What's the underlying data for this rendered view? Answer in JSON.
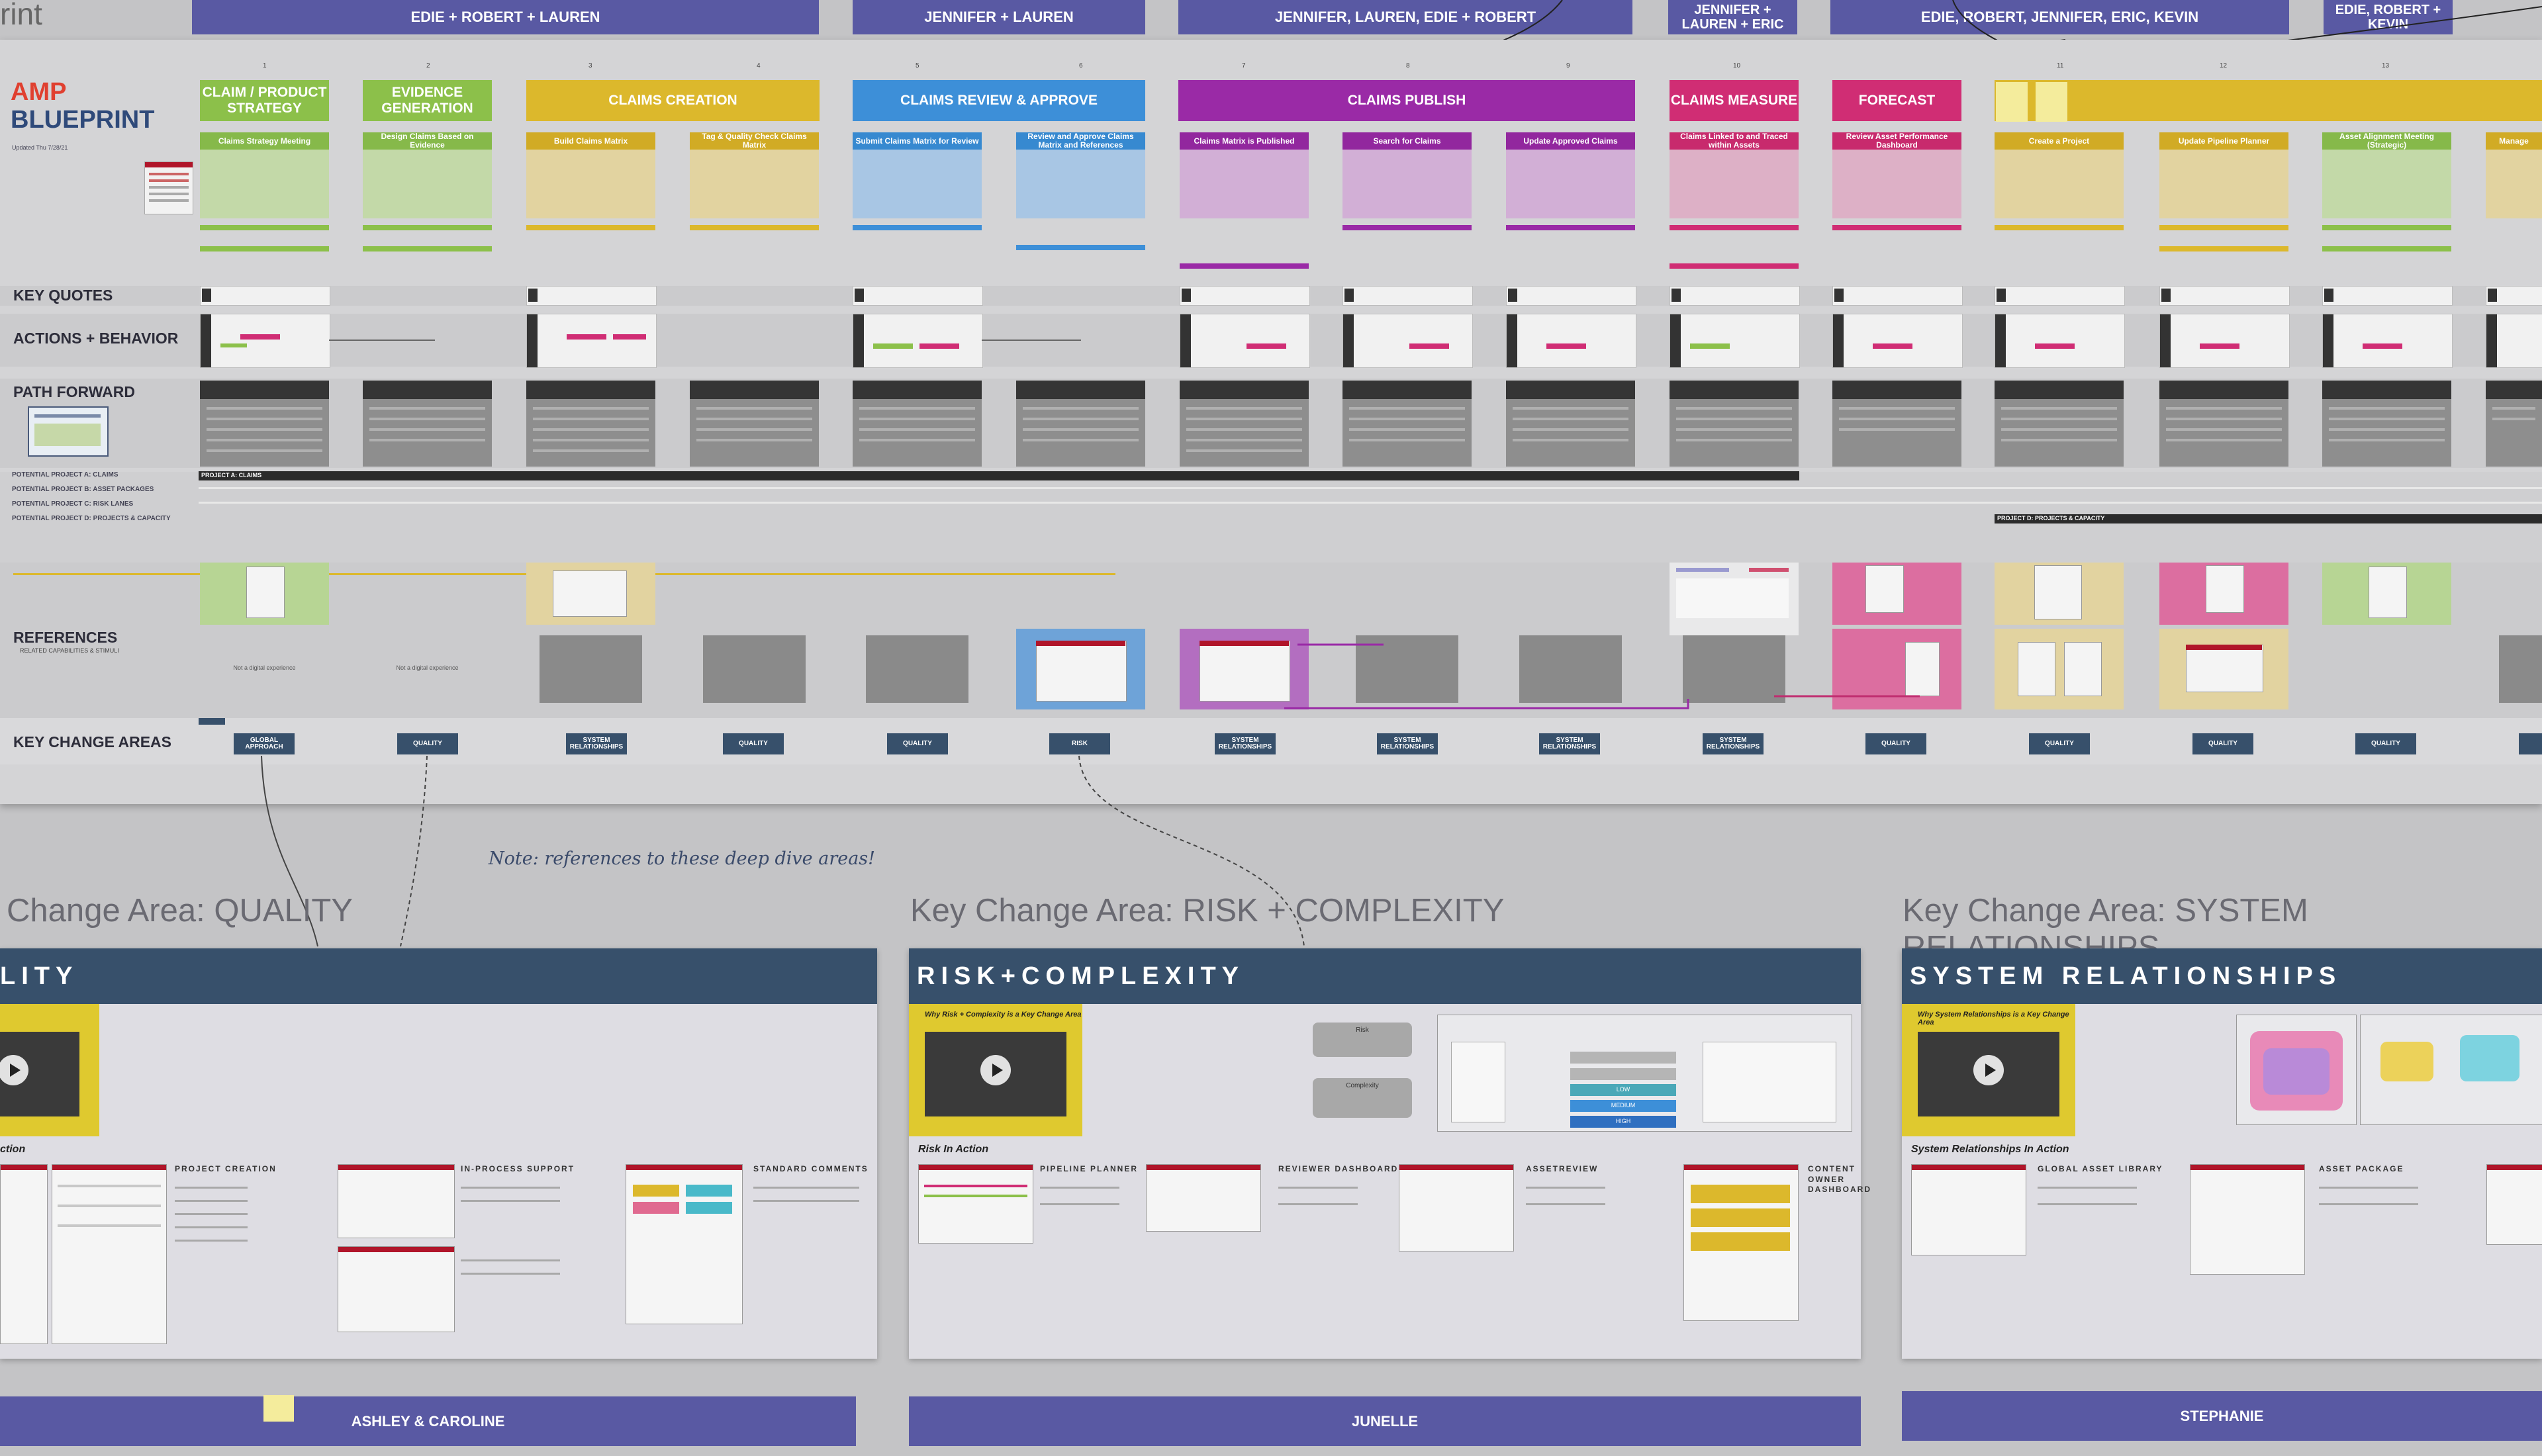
{
  "board": {
    "frame_title": "rint",
    "title_line1": "AMP",
    "title_line2": "BLUEPRINT",
    "updated": "Updated Thu 7/28/21",
    "teams": [
      {
        "label": "EDIE + ROBERT + LAUREN"
      },
      {
        "label": "JENNIFER + LAUREN"
      },
      {
        "label": "JENNIFER, LAUREN, EDIE + ROBERT"
      },
      {
        "label": "JENNIFER + LAUREN + ERIC"
      },
      {
        "label": "EDIE, ROBERT, JENNIFER, ERIC, KEVIN"
      },
      {
        "label": "EDIE, ROBERT + KEVIN"
      }
    ],
    "step_numbers": [
      "1",
      "2",
      "3",
      "4",
      "5",
      "6",
      "7",
      "8",
      "9",
      "10",
      "11",
      "12",
      "13"
    ],
    "stages": [
      {
        "label": "CLAIM / PRODUCT STRATEGY",
        "color": "#8cc04a"
      },
      {
        "label": "EVIDENCE GENERATION",
        "color": "#8cc04a"
      },
      {
        "label": "CLAIMS CREATION",
        "color": "#dcb82c"
      },
      {
        "label": "CLAIMS REVIEW & APPROVE",
        "color": "#3d8fd8"
      },
      {
        "label": "CLAIMS PUBLISH",
        "color": "#9a2aa6"
      },
      {
        "label": "CLAIMS MEASURE",
        "color": "#d02d74"
      },
      {
        "label": "FORECAST",
        "color": "#d02d74"
      }
    ],
    "sub_steps": [
      {
        "label": "Claims Strategy Meeting"
      },
      {
        "label": "Design Claims Based on Evidence"
      },
      {
        "label": "Build Claims Matrix"
      },
      {
        "label": "Tag & Quality Check Claims Matrix"
      },
      {
        "label": "Submit Claims Matrix for Review"
      },
      {
        "label": "Review and Approve Claims Matrix and References"
      },
      {
        "label": "Claims Matrix is Published"
      },
      {
        "label": "Search for Claims"
      },
      {
        "label": "Update Approved Claims"
      },
      {
        "label": "Claims Linked to and Traced within Assets"
      },
      {
        "label": "Review Asset Performance Dashboard"
      },
      {
        "label": "Create a Project"
      },
      {
        "label": "Update Pipeline Planner"
      },
      {
        "label": "Asset Alignment Meeting (Strategic)"
      },
      {
        "label": "Manage"
      }
    ],
    "row_labels": {
      "key_quotes": "KEY QUOTES",
      "actions": "ACTIONS + BEHAVIOR",
      "path_forward": "PATH FORWARD",
      "references": "REFERENCES",
      "references_sub": "RELATED CAPABILITIES & STIMULI",
      "key_change_areas": "KEY CHANGE AREAS"
    },
    "potential_projects": [
      {
        "label": "POTENTIAL PROJECT A: CLAIMS"
      },
      {
        "label": "POTENTIAL PROJECT B: ASSET PACKAGES"
      },
      {
        "label": "POTENTIAL PROJECT C: RISK LANES"
      },
      {
        "label": "POTENTIAL PROJECT D: PROJECTS & CAPACITY"
      }
    ],
    "project_bar_a": "PROJECT A: CLAIMS",
    "project_bar_d": "PROJECT D: PROJECTS & CAPACITY",
    "key_change_tags": [
      {
        "label": "GLOBAL APPROACH"
      },
      {
        "label": "QUALITY"
      },
      {
        "label": "SYSTEM RELATIONSHIPS"
      },
      {
        "label": "QUALITY"
      },
      {
        "label": "QUALITY"
      },
      {
        "label": "RISK"
      },
      {
        "label": "SYSTEM RELATIONSHIPS"
      },
      {
        "label": "SYSTEM RELATIONSHIPS"
      },
      {
        "label": "SYSTEM RELATIONSHIPS"
      },
      {
        "label": "SYSTEM RELATIONSHIPS"
      },
      {
        "label": "QUALITY"
      },
      {
        "label": "QUALITY"
      },
      {
        "label": "QUALITY"
      },
      {
        "label": "QUALITY"
      }
    ],
    "ref_captions": [
      {
        "label": "Not a digital experience"
      },
      {
        "label": "Not a digital experience"
      }
    ]
  },
  "note": "Note: references to these deep dive areas!",
  "deep_dives": [
    {
      "title": "Key Change Area: QUALITY",
      "bar": "LITY",
      "video_caption": "",
      "in_action": "ction",
      "sections": [
        {
          "label": "PROJECT CREATION"
        },
        {
          "label": "IN-PROCESS SUPPORT"
        },
        {
          "label": "STANDARD COMMENTS"
        }
      ],
      "owner": "ASHLEY & CAROLINE"
    },
    {
      "title": "Key Change Area: RISK + COMPLEXITY",
      "bar": "RISK+COMPLEXITY",
      "video_caption": "Why Risk + Complexity is a Key Change Area",
      "in_action": "Risk In Action",
      "sections": [
        {
          "label": "PIPELINE PLANNER"
        },
        {
          "label": "REVIEWER DASHBOARD"
        },
        {
          "label": "ASSETREVIEW"
        },
        {
          "label": "CONTENT OWNER DASHBOARD"
        }
      ],
      "diagram_labels": {
        "risk": "Risk",
        "complexity": "Complexity",
        "low": "LOW",
        "medium": "MEDIUM",
        "high": "HIGH"
      },
      "owner": "JUNELLE"
    },
    {
      "title": "Key Change Area: SYSTEM RELATIONSHIPS",
      "bar": "SYSTEM RELATIONSHIPS",
      "video_caption": "Why System Relationships is a Key Change Area",
      "in_action": "System Relationships In Action",
      "sections": [
        {
          "label": "GLOBAL ASSET LIBRARY"
        },
        {
          "label": "ASSET PACKAGE"
        }
      ],
      "owner": "STEPHANIE"
    }
  ],
  "colors": {
    "team_bar": "#5959a3",
    "navy": "#37506b",
    "accent_red": "#e04030",
    "amp_blue": "#2f4a7a"
  }
}
